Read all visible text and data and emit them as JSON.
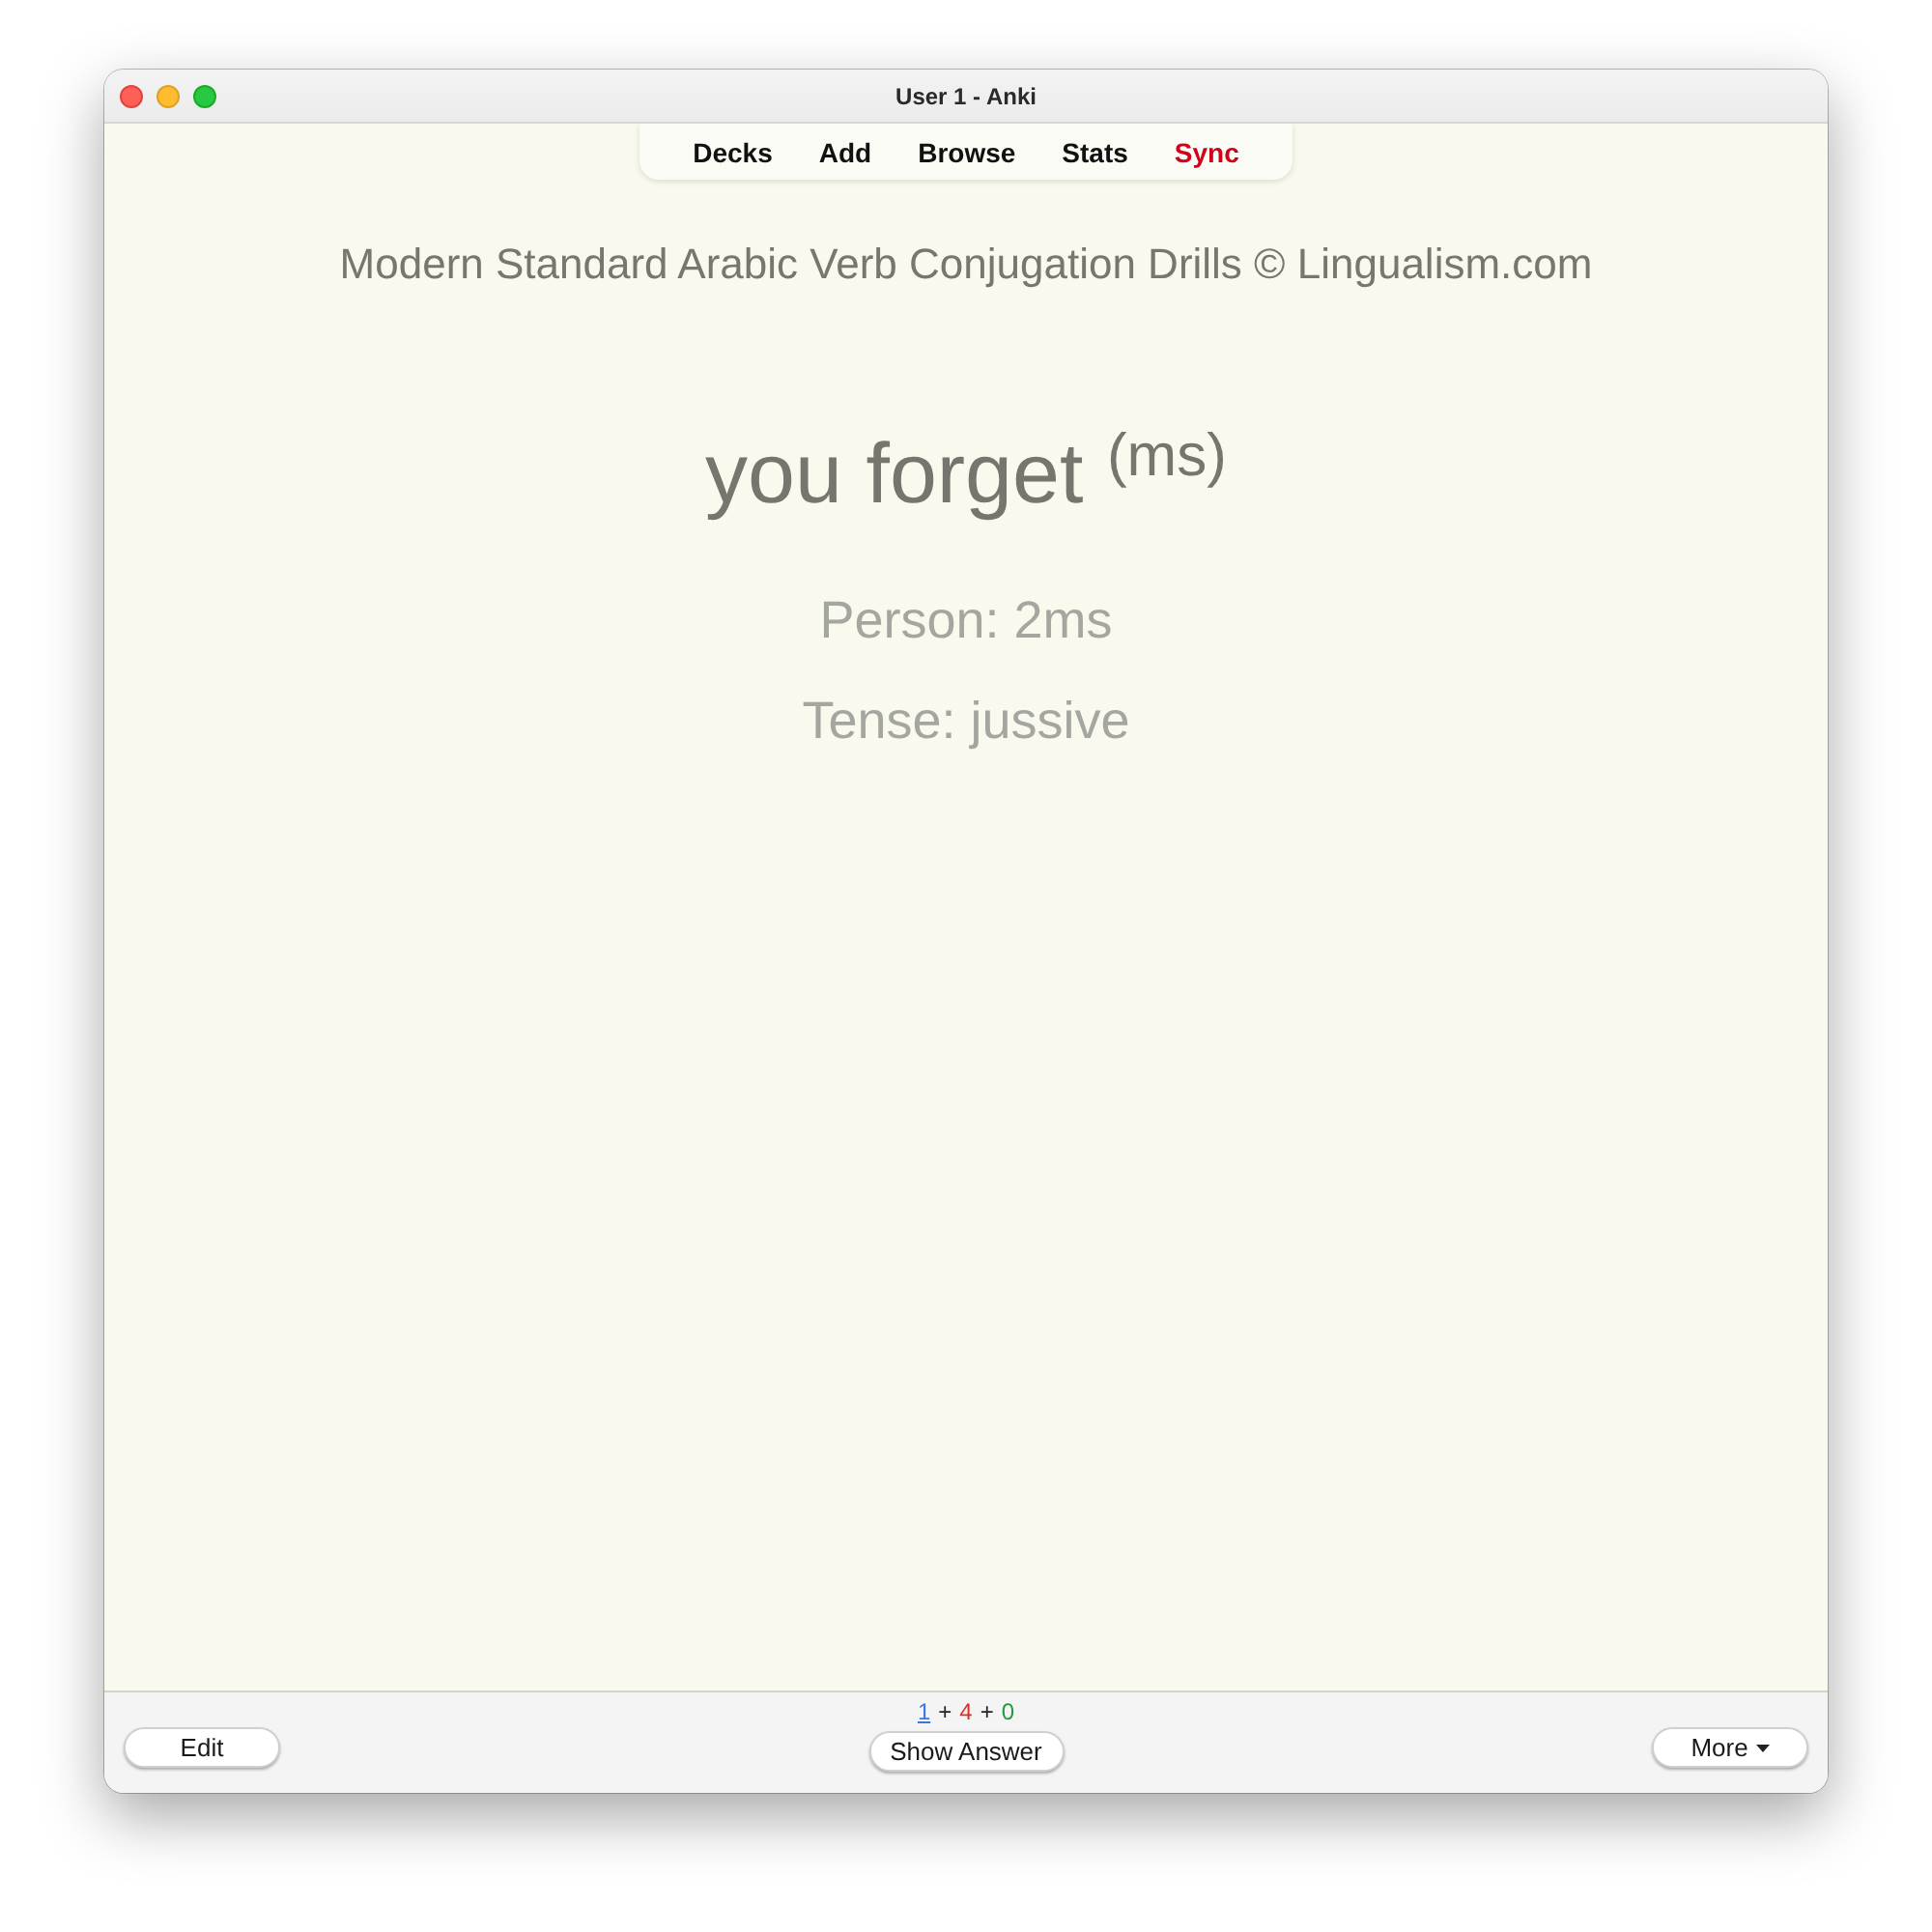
{
  "window": {
    "title": "User 1 - Anki"
  },
  "toolbar": [
    {
      "label": "Decks",
      "alert": false
    },
    {
      "label": "Add",
      "alert": false
    },
    {
      "label": "Browse",
      "alert": false
    },
    {
      "label": "Stats",
      "alert": false
    },
    {
      "label": "Sync",
      "alert": true
    }
  ],
  "card": {
    "header": "Modern Standard Arabic Verb Conjugation Drills © Lingualism.com",
    "prompt": "you forget $^{(ms)}$",
    "fields": [
      "Person: 2ms",
      "Tense: jussive"
    ]
  },
  "bottom_bar": {
    "edit_button": "Edit",
    "counts": [
      {
        "text": "1",
        "color": "#3b78d8",
        "selected": true
      },
      {
        "text": "4",
        "color": "#d9302a",
        "selected": false
      },
      {
        "text": "0",
        "color": "#1f9a3c",
        "selected": false
      }
    ],
    "separators": [
      "+",
      "+"
    ],
    "show_answer_button": "Show Answer",
    "more_button": "More"
  }
}
